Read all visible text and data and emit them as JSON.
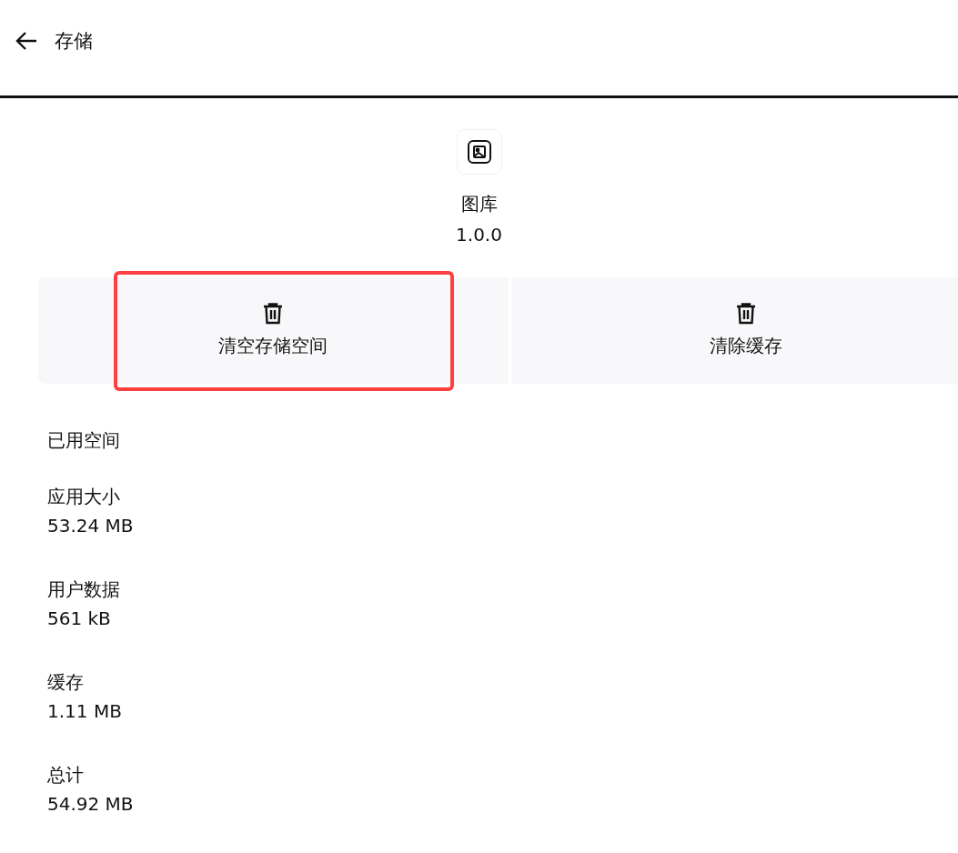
{
  "header": {
    "title": "存储"
  },
  "app": {
    "name": "图库",
    "version": "1.0.0"
  },
  "actions": [
    {
      "label": "清空存储空间",
      "highlighted": true
    },
    {
      "label": "清除缓存",
      "highlighted": false
    }
  ],
  "section_title": "已用空间",
  "items": [
    {
      "label": "应用大小",
      "value": "53.24 MB"
    },
    {
      "label": "用户数据",
      "value": "561 kB"
    },
    {
      "label": "缓存",
      "value": "1.11 MB"
    },
    {
      "label": "总计",
      "value": "54.92 MB"
    }
  ]
}
